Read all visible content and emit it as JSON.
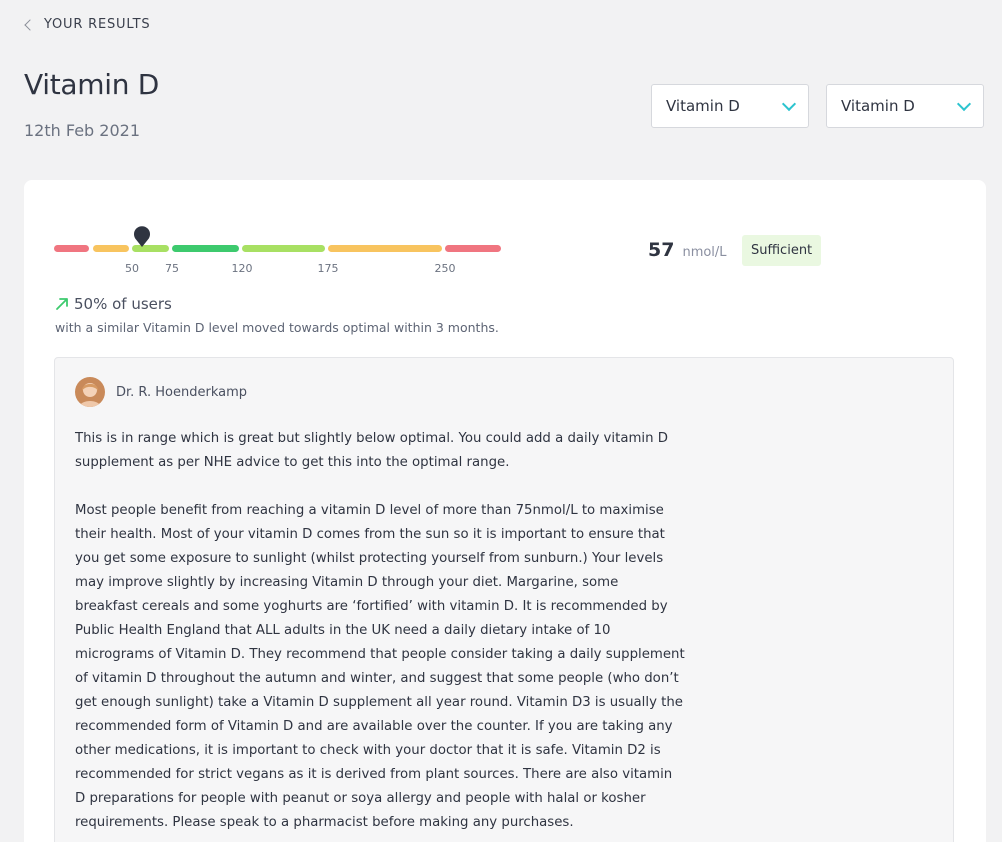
{
  "nav": {
    "back_label": "YOUR RESULTS"
  },
  "header": {
    "title": "Vitamin D",
    "date": "12th Feb 2021"
  },
  "selectors": [
    {
      "value": "Vitamin D"
    },
    {
      "value": "Vitamin D"
    }
  ],
  "range": {
    "ticks": [
      "50",
      "75",
      "120",
      "175",
      "250"
    ],
    "segment_colors": [
      "#f07580",
      "#f8c45f",
      "#a8e063",
      "#3dca6e",
      "#a8e063",
      "#f8c45f",
      "#f07580"
    ]
  },
  "result": {
    "value": "57",
    "unit": "nmol/L",
    "status": "Sufficient",
    "status_color": "#eaf8e1"
  },
  "trend": {
    "icon": "arrow-up-right-icon",
    "label": "50% of users",
    "description": "with a similar Vitamin D level moved towards optimal within 3 months."
  },
  "advice": {
    "doctor_name": "Dr. R. Hoenderkamp",
    "paragraphs": [
      "This is in range which is great but slightly below optimal. You could add a daily vitamin D supplement as per NHE advice to get this into the optimal range.",
      "Most people benefit from reaching a vitamin D level of more than 75nmol/L to maximise their health. Most of your vitamin D comes from the sun so it is important to ensure that you get some exposure to sunlight (whilst protecting yourself from sunburn.) Your levels may improve slightly by increasing Vitamin D through your diet. Margarine, some breakfast cereals and some yoghurts are ‘fortified’ with vitamin D. It is recommended by Public Health England that ALL adults in the UK need a daily dietary intake of 10 micrograms of Vitamin D. They recommend that people consider taking a daily supplement of vitamin D throughout the autumn and winter, and suggest that some people (who don’t get enough sunlight) take a Vitamin D supplement all year round. Vitamin D3 is usually the recommended form of Vitamin D and are available over the counter. If you are taking any other medications, it is important to check with your doctor that it is safe. Vitamin D2 is recommended for strict vegans as it is derived from plant sources. There are also vitamin D preparations for people with peanut or soya allergy and people with halal or kosher requirements. Please speak to a pharmacist before making any purchases."
    ]
  },
  "colors": {
    "accent": "#2cc4cf",
    "trend_arrow": "#3dca6e",
    "marker": "#2f3441"
  }
}
